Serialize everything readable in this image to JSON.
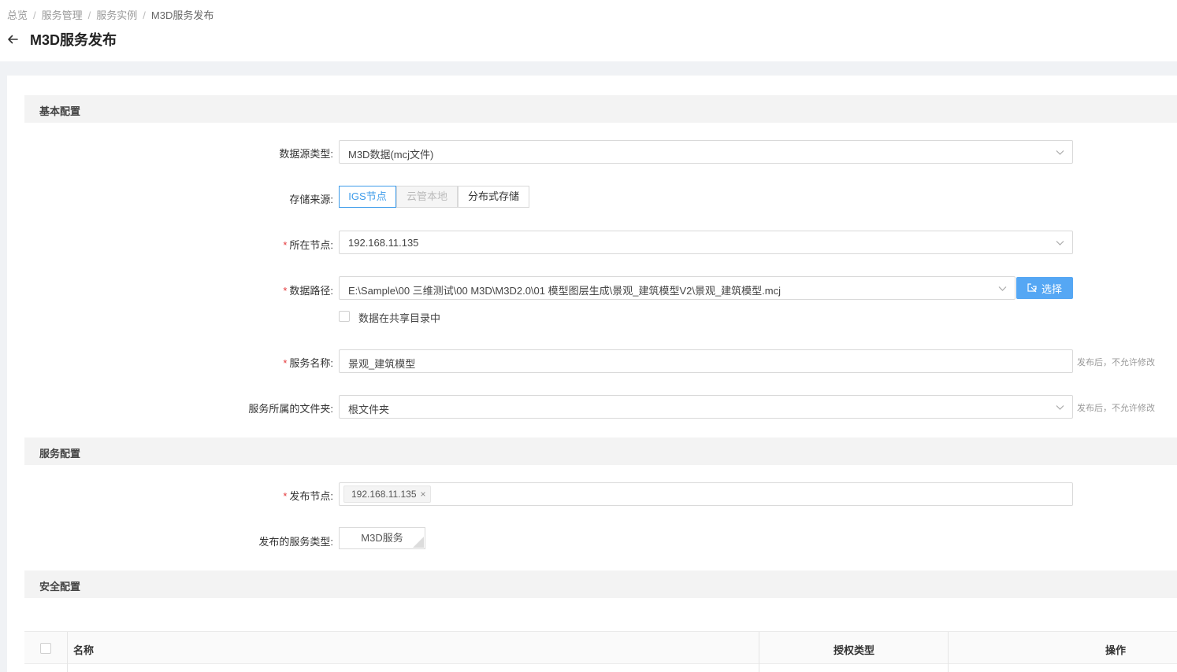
{
  "breadcrumb": [
    "总览",
    "服务管理",
    "服务实例",
    "M3D服务发布"
  ],
  "breadcrumb_sep": "/",
  "page_title": "M3D服务发布",
  "sections": {
    "basic": "基本配置",
    "service": "服务配置",
    "security": "安全配置"
  },
  "form": {
    "datasource_type": {
      "label": "数据源类型:",
      "value": "M3D数据(mcj文件)"
    },
    "storage_source": {
      "label": "存储来源:",
      "options": [
        "IGS节点",
        "云管本地",
        "分布式存储"
      ],
      "selected": "IGS节点",
      "disabled": [
        "云管本地"
      ]
    },
    "node": {
      "label": "所在节点:",
      "value": "192.168.11.135"
    },
    "data_path": {
      "label": "数据路径:",
      "value": "E:\\Sample\\00 三维测试\\00 M3D\\M3D2.0\\01 模型图层生成\\景观_建筑模型V2\\景观_建筑模型.mcj",
      "choose_button": "选择"
    },
    "shared_dir": {
      "label": "数据在共享目录中",
      "checked": false
    },
    "service_name": {
      "label": "服务名称:",
      "value": "景观_建筑模型",
      "hint": "发布后，不允许修改"
    },
    "folder": {
      "label": "服务所属的文件夹:",
      "value": "根文件夹",
      "hint": "发布后，不允许修改"
    },
    "publish_node": {
      "label": "发布节点:",
      "tags": [
        "192.168.11.135"
      ]
    },
    "service_type": {
      "label": "发布的服务类型:",
      "value": "M3D服务"
    }
  },
  "table": {
    "columns": [
      "名称",
      "授权类型",
      "操作"
    ]
  },
  "colors": {
    "accent": "#3d9bea",
    "button": "#55a7f4",
    "required": "#e4393c",
    "background": "#f0f2f5"
  }
}
